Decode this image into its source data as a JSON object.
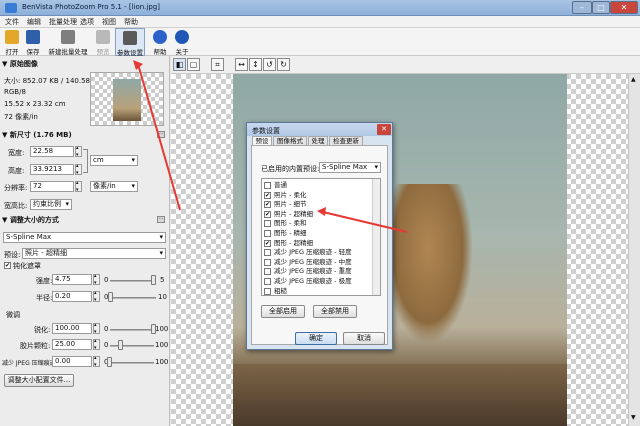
{
  "window": {
    "title": "BenVista PhotoZoom Pro 5.1 - [lion.jpg]"
  },
  "menu": [
    "文件",
    "编辑",
    "批量处理",
    "选项",
    "视图",
    "帮助"
  ],
  "toolbar": {
    "buttons": [
      {
        "label": "打开",
        "icon": "folder-open-icon",
        "color": "#e2a82a"
      },
      {
        "label": "保存",
        "icon": "floppy-disk-icon",
        "color": "#2f5fa8"
      },
      {
        "label": "新建批量处理",
        "icon": "batch-stack-icon",
        "color": "#7f7f7f"
      },
      {
        "label": "预览",
        "icon": "printer-icon",
        "color": "#b9b9b9"
      },
      {
        "label": "参数设置",
        "icon": "tools-icon",
        "color": "#5a5a5a"
      },
      {
        "label": "帮助",
        "icon": "help-icon",
        "color": "#2a62c9"
      },
      {
        "label": "关于",
        "icon": "info-icon",
        "color": "#1f57b9"
      }
    ]
  },
  "original_image": {
    "header": "原始图像",
    "size": "大小: 852.07 KB / 140.58 KB",
    "mode": "RGB/8",
    "dims": "15.52 x 23.32 cm",
    "resolution": "72 像素/in"
  },
  "new_size": {
    "header": "新尺寸 (1.76 MB)",
    "width_label": "宽度:",
    "width": "22.58",
    "height_label": "高度:",
    "height": "33.9213",
    "unit": "cm",
    "res_label": "分辨率:",
    "res": "72",
    "res_unit": "像素/in",
    "aspect_label": "宽高比:",
    "aspect": "约束比例"
  },
  "resize_method": {
    "header": "调整大小的方式",
    "method": "S-Spline Max",
    "preset_label": "预设:",
    "preset": "照片 - 超精细",
    "sharpen_label": "钝化遮罩",
    "strength_label": "强度:",
    "strength": "4.75",
    "strength_min": "0",
    "strength_max": "5",
    "strength_pos": 0.95,
    "radius_label": "半径:",
    "radius": "0.20",
    "radius_min": "0",
    "radius_max": "10",
    "radius_pos": 0.02,
    "fine_label": "微调",
    "sharp_label": "锐化:",
    "sharp": "100.00",
    "sharp_min": "0",
    "sharp_max": "100",
    "sharp_pos": 1.0,
    "film_label": "胶片颗粒:",
    "film": "25.00",
    "film_min": "0",
    "film_max": "100",
    "film_pos": 0.25,
    "jpeg_label": "减少 JPEG 压缩痕迹:",
    "jpeg": "0.00",
    "jpeg_min": "0",
    "jpeg_max": "100",
    "jpeg_pos": 0.0,
    "profile_button": "调整大小配置文件..."
  },
  "dialog": {
    "title": "参数设置",
    "tabs": [
      "预设",
      "图像格式",
      "处理",
      "检查更新"
    ],
    "preset_label": "已启用的内置预设:",
    "preset_value": "S-Spline Max",
    "items": [
      {
        "label": "普通",
        "checked": false
      },
      {
        "label": "照片 - 柔化",
        "checked": true
      },
      {
        "label": "照片 - 细节",
        "checked": true
      },
      {
        "label": "照片 - 超精细",
        "checked": true
      },
      {
        "label": "图形 - 柔和",
        "checked": false
      },
      {
        "label": "图形 - 精细",
        "checked": false
      },
      {
        "label": "图形 - 超精细",
        "checked": true
      },
      {
        "label": "减少 JPEG 压缩痕迹 - 轻度",
        "checked": false
      },
      {
        "label": "减少 JPEG 压缩痕迹 - 中度",
        "checked": false
      },
      {
        "label": "减少 JPEG 压缩痕迹 - 重度",
        "checked": false
      },
      {
        "label": "减少 JPEG 压缩痕迹 - 极度",
        "checked": false
      },
      {
        "label": "粗糙",
        "checked": false
      }
    ],
    "enable_all": "全部启用",
    "disable_all": "全部禁用",
    "ok": "确定",
    "cancel": "取消"
  },
  "colors": {
    "accent": "#3a6ea5",
    "annotation": "#e53935"
  }
}
